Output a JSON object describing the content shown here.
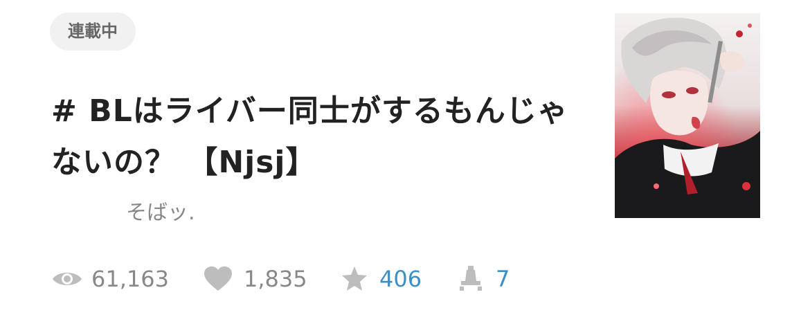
{
  "badge": {
    "label": "連載中"
  },
  "story": {
    "title": "# BLはライバー同士がするもんじゃないの？ 【Njsj】",
    "author": "そばッ."
  },
  "stats": {
    "views": "61,163",
    "likes": "1,835",
    "stars": "406",
    "comments": "7"
  },
  "colors": {
    "muted": "#888888",
    "accent": "#3a8fc9",
    "icon": "#bdbdbd"
  },
  "icons": {
    "views": "eye-icon",
    "likes": "heart-icon",
    "stars": "star-icon",
    "comments": "stamp-icon"
  }
}
